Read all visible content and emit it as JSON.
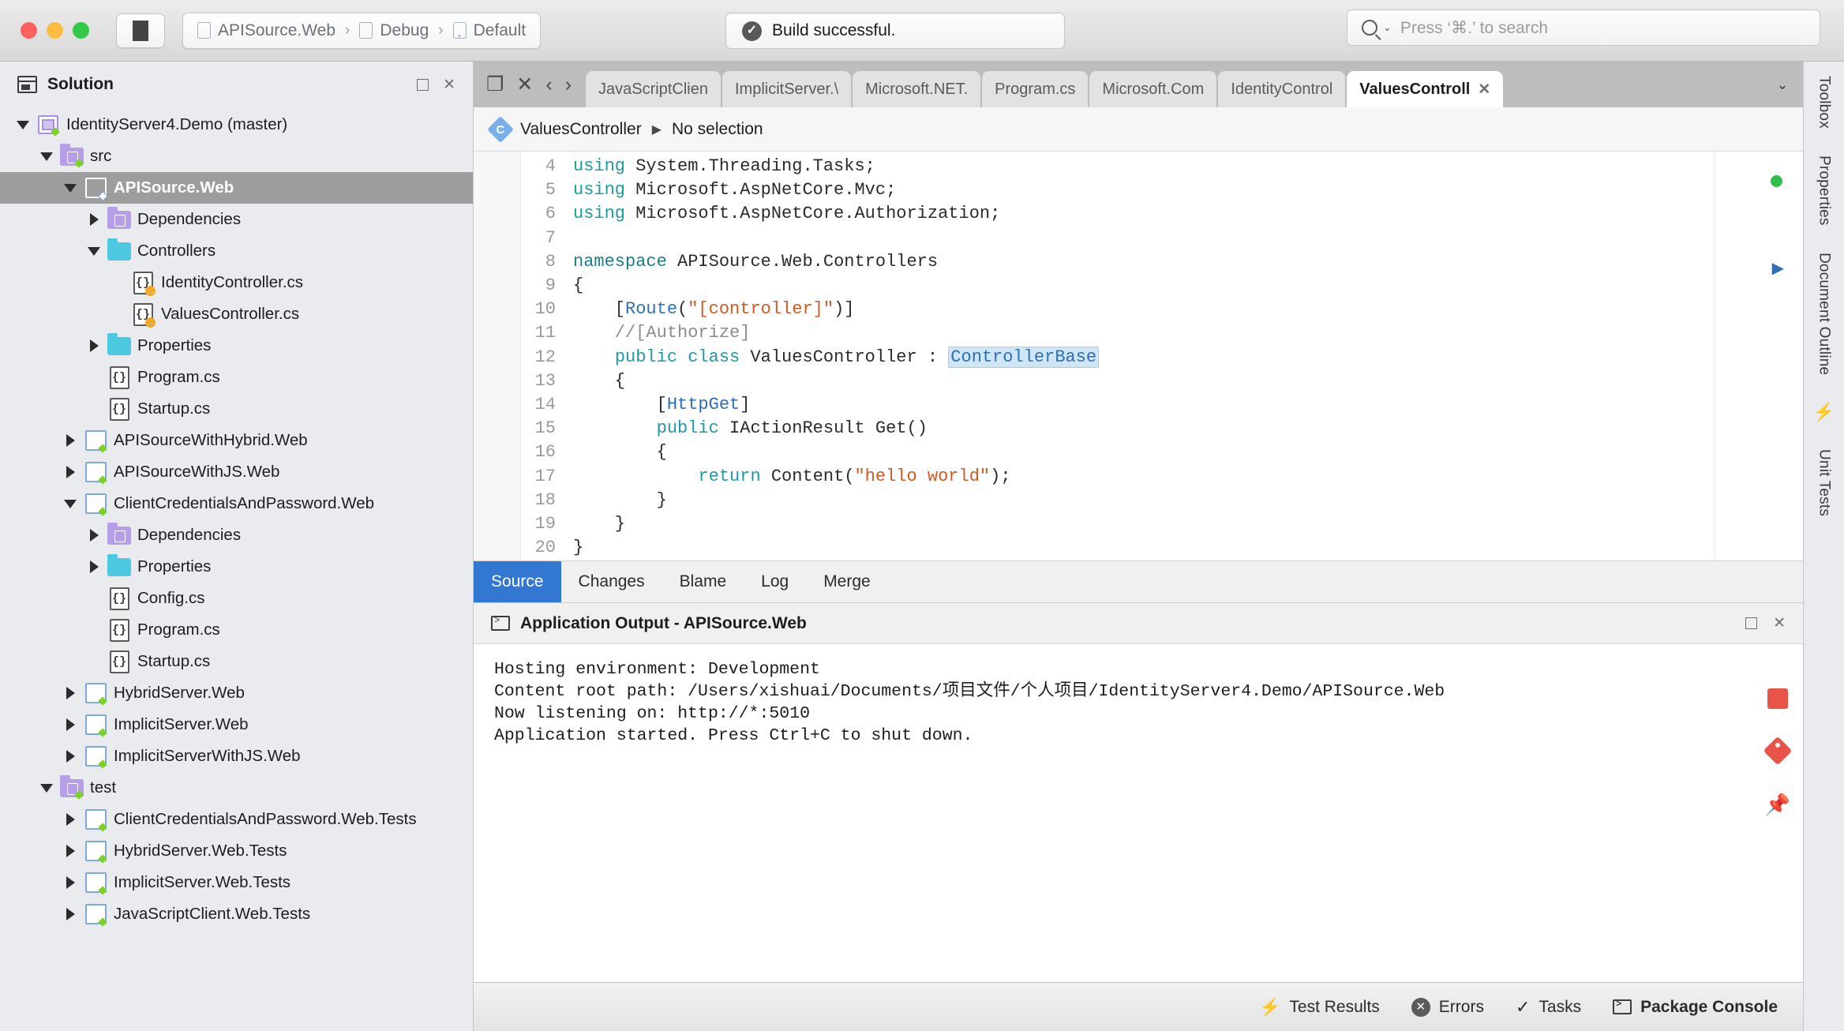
{
  "titlebar": {
    "stop_button": "stop-square",
    "breadcrumb": [
      {
        "icon": "project-icon",
        "label": "APISource.Web"
      },
      {
        "icon": "config-icon",
        "label": "Debug"
      },
      {
        "icon": "device-icon",
        "label": "Default"
      }
    ],
    "separator": "›",
    "status": {
      "icon": "check-badge",
      "text": "Build successful."
    },
    "search": {
      "icon": "search-icon",
      "placeholder": "Press ‘⌘.’ to search",
      "caret": "⌄"
    }
  },
  "sidebar": {
    "title": "Solution",
    "header_icon": "solution-pad-icon",
    "minimize_label": "❐",
    "close_label": "✕",
    "tree": [
      {
        "label": "IdentityServer4.Demo (master)",
        "indent": 0,
        "twisty": "down",
        "icon": "solution-icon",
        "badge": "green",
        "selected": false
      },
      {
        "label": "src",
        "indent": 1,
        "twisty": "down",
        "icon": "folder-purple-icon",
        "badge": "green",
        "selected": false
      },
      {
        "label": "APISource.Web",
        "indent": 2,
        "twisty": "down",
        "icon": "project-white-icon",
        "badge": "blue",
        "selected": true
      },
      {
        "label": "Dependencies",
        "indent": 3,
        "twisty": "right",
        "icon": "folder-purple-icon",
        "badge": "",
        "selected": false
      },
      {
        "label": "Controllers",
        "indent": 3,
        "twisty": "down",
        "icon": "folder-cyan-icon",
        "badge": "",
        "selected": false
      },
      {
        "label": "IdentityController.cs",
        "indent": 4,
        "twisty": "none",
        "icon": "cs-file-icon",
        "badge": "amber",
        "selected": false
      },
      {
        "label": "ValuesController.cs",
        "indent": 4,
        "twisty": "none",
        "icon": "cs-file-icon",
        "badge": "amber",
        "selected": false
      },
      {
        "label": "Properties",
        "indent": 3,
        "twisty": "right",
        "icon": "folder-cyan-icon",
        "badge": "",
        "selected": false
      },
      {
        "label": "Program.cs",
        "indent": 3,
        "twisty": "none",
        "icon": "cs-file-icon",
        "badge": "",
        "selected": false
      },
      {
        "label": "Startup.cs",
        "indent": 3,
        "twisty": "none",
        "icon": "cs-file-icon",
        "badge": "",
        "selected": false
      },
      {
        "label": "APISourceWithHybrid.Web",
        "indent": 2,
        "twisty": "right",
        "icon": "project-icon",
        "badge": "green",
        "selected": false
      },
      {
        "label": "APISourceWithJS.Web",
        "indent": 2,
        "twisty": "right",
        "icon": "project-icon",
        "badge": "green",
        "selected": false
      },
      {
        "label": "ClientCredentialsAndPassword.Web",
        "indent": 2,
        "twisty": "down",
        "icon": "project-icon",
        "badge": "green",
        "selected": false
      },
      {
        "label": "Dependencies",
        "indent": 3,
        "twisty": "right",
        "icon": "folder-purple-icon",
        "badge": "",
        "selected": false
      },
      {
        "label": "Properties",
        "indent": 3,
        "twisty": "right",
        "icon": "folder-cyan-icon",
        "badge": "",
        "selected": false
      },
      {
        "label": "Config.cs",
        "indent": 3,
        "twisty": "none",
        "icon": "cs-file-icon",
        "badge": "",
        "selected": false
      },
      {
        "label": "Program.cs",
        "indent": 3,
        "twisty": "none",
        "icon": "cs-file-icon",
        "badge": "",
        "selected": false
      },
      {
        "label": "Startup.cs",
        "indent": 3,
        "twisty": "none",
        "icon": "cs-file-icon",
        "badge": "",
        "selected": false
      },
      {
        "label": "HybridServer.Web",
        "indent": 2,
        "twisty": "right",
        "icon": "project-icon",
        "badge": "green",
        "selected": false
      },
      {
        "label": "ImplicitServer.Web",
        "indent": 2,
        "twisty": "right",
        "icon": "project-icon",
        "badge": "green",
        "selected": false
      },
      {
        "label": "ImplicitServerWithJS.Web",
        "indent": 2,
        "twisty": "right",
        "icon": "project-icon",
        "badge": "green",
        "selected": false
      },
      {
        "label": "test",
        "indent": 1,
        "twisty": "down",
        "icon": "folder-purple-icon",
        "badge": "green",
        "selected": false
      },
      {
        "label": "ClientCredentialsAndPassword.Web.Tests",
        "indent": 2,
        "twisty": "right",
        "icon": "project-icon",
        "badge": "green",
        "selected": false
      },
      {
        "label": "HybridServer.Web.Tests",
        "indent": 2,
        "twisty": "right",
        "icon": "project-icon",
        "badge": "green",
        "selected": false
      },
      {
        "label": "ImplicitServer.Web.Tests",
        "indent": 2,
        "twisty": "right",
        "icon": "project-icon",
        "badge": "green",
        "selected": false
      },
      {
        "label": "JavaScriptClient.Web.Tests",
        "indent": 2,
        "twisty": "right",
        "icon": "project-icon",
        "badge": "green",
        "selected": false
      }
    ]
  },
  "editor": {
    "nav_back": "‹",
    "nav_forward": "›",
    "pin_icon": "❐",
    "close_icon": "✕",
    "chevron_icon": "⌄",
    "tabs": [
      {
        "label": "JavaScriptClien",
        "active": false
      },
      {
        "label": "ImplicitServer.\\",
        "active": false
      },
      {
        "label": "Microsoft.NET.",
        "active": false
      },
      {
        "label": "Program.cs",
        "active": false
      },
      {
        "label": "Microsoft.Com",
        "active": false
      },
      {
        "label": "IdentityControl",
        "active": false
      },
      {
        "label": "ValuesControll",
        "active": true
      }
    ],
    "breadcrumb": {
      "icon": "csharp-class-icon",
      "class_name": "ValuesController",
      "arrow": "▶",
      "selection": "No selection"
    },
    "code_lines": [
      {
        "num": "4",
        "tokens": [
          {
            "t": "using ",
            "c": "kw"
          },
          {
            "t": "System.Threading.Tasks;",
            "c": "typ"
          }
        ]
      },
      {
        "num": "5",
        "tokens": [
          {
            "t": "using ",
            "c": "kw"
          },
          {
            "t": "Microsoft.AspNetCore.Mvc;",
            "c": "typ"
          }
        ]
      },
      {
        "num": "6",
        "tokens": [
          {
            "t": "using ",
            "c": "kw"
          },
          {
            "t": "Microsoft.AspNetCore.Authorization;",
            "c": "typ"
          }
        ]
      },
      {
        "num": "7",
        "tokens": []
      },
      {
        "num": "8",
        "tokens": [
          {
            "t": "namespace ",
            "c": "ns"
          },
          {
            "t": "APISource.Web.Controllers",
            "c": "typ"
          }
        ]
      },
      {
        "num": "9",
        "tokens": [
          {
            "t": "{",
            "c": "typ"
          }
        ]
      },
      {
        "num": "10",
        "tokens": [
          {
            "t": "    [",
            "c": "typ"
          },
          {
            "t": "Route",
            "c": "attr"
          },
          {
            "t": "(",
            "c": "typ"
          },
          {
            "t": "\"[controller]\"",
            "c": "str"
          },
          {
            "t": ")]",
            "c": "typ"
          }
        ]
      },
      {
        "num": "11",
        "tokens": [
          {
            "t": "    //[Authorize]",
            "c": "cmt"
          }
        ]
      },
      {
        "num": "12",
        "tokens": [
          {
            "t": "    ",
            "c": "typ"
          },
          {
            "t": "public class ",
            "c": "kw"
          },
          {
            "t": "ValuesController",
            "c": "typ"
          },
          {
            "t": " : ",
            "c": "typ"
          },
          {
            "t": "ControllerBase",
            "c": "hl"
          }
        ]
      },
      {
        "num": "13",
        "tokens": [
          {
            "t": "    {",
            "c": "typ"
          }
        ]
      },
      {
        "num": "14",
        "tokens": [
          {
            "t": "        [",
            "c": "typ"
          },
          {
            "t": "HttpGet",
            "c": "attr"
          },
          {
            "t": "]",
            "c": "typ"
          }
        ]
      },
      {
        "num": "15",
        "tokens": [
          {
            "t": "        ",
            "c": "typ"
          },
          {
            "t": "public ",
            "c": "kw"
          },
          {
            "t": "IActionResult",
            "c": "typ"
          },
          {
            "t": " Get()",
            "c": "typ"
          }
        ]
      },
      {
        "num": "16",
        "tokens": [
          {
            "t": "        {",
            "c": "typ"
          }
        ]
      },
      {
        "num": "17",
        "tokens": [
          {
            "t": "            ",
            "c": "typ"
          },
          {
            "t": "return",
            "c": "kw"
          },
          {
            "t": " Content(",
            "c": "typ"
          },
          {
            "t": "\"hello world\"",
            "c": "str"
          },
          {
            "t": ");",
            "c": "typ"
          }
        ]
      },
      {
        "num": "18",
        "tokens": [
          {
            "t": "        }",
            "c": "typ"
          }
        ]
      },
      {
        "num": "19",
        "tokens": [
          {
            "t": "    }",
            "c": "typ"
          }
        ]
      },
      {
        "num": "20",
        "tokens": [
          {
            "t": "}",
            "c": "typ"
          }
        ]
      }
    ],
    "source_tabs": [
      {
        "label": "Source",
        "active": true
      },
      {
        "label": "Changes",
        "active": false
      },
      {
        "label": "Blame",
        "active": false
      },
      {
        "label": "Log",
        "active": false
      },
      {
        "label": "Merge",
        "active": false
      }
    ],
    "rail": {
      "green_dot_color": "#2fbf4a",
      "play_icon": "▶"
    }
  },
  "output": {
    "icon": "terminal-icon",
    "title": "Application Output - APISource.Web",
    "minimize_label": "❐",
    "close_label": "✕",
    "lines": [
      "Hosting environment: Development",
      "Content root path: /Users/xishuai/Documents/项目文件/个人项目/IdentityServer4.Demo/APISource.Web",
      "Now listening on: http://*:5010",
      "Application started. Press Ctrl+C to shut down."
    ],
    "rail_icons": [
      "stop-icon",
      "tag-icon",
      "pin-icon"
    ]
  },
  "statusbar": {
    "items": [
      {
        "icon": "bolt-icon",
        "label": "Test Results",
        "strong": false
      },
      {
        "icon": "error-icon",
        "label": "Errors",
        "strong": false
      },
      {
        "icon": "check-icon",
        "label": "Tasks",
        "strong": false
      },
      {
        "icon": "console-icon",
        "label": "Package Console",
        "strong": true
      }
    ]
  },
  "right_dock": {
    "items": [
      "Toolbox",
      "Properties",
      "Document Outline",
      "Unit Tests"
    ],
    "divider_icon": "⚡"
  }
}
